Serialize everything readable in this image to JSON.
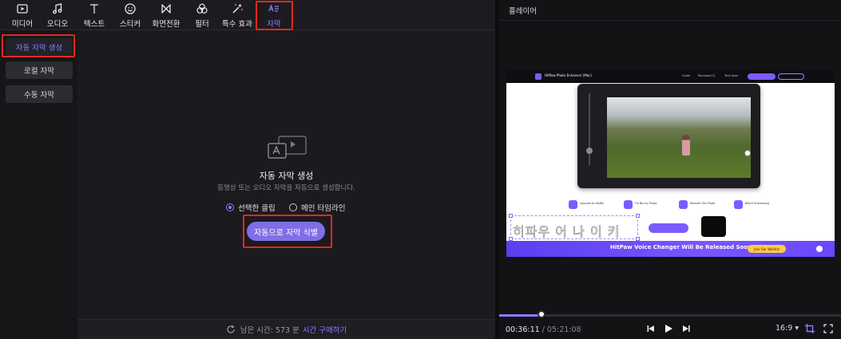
{
  "toolbar": {
    "tools": [
      {
        "label": "미디어",
        "icon": "media-icon"
      },
      {
        "label": "오디오",
        "icon": "music-note-icon"
      },
      {
        "label": "텍스트",
        "icon": "text-icon"
      },
      {
        "label": "스티커",
        "icon": "sticker-icon"
      },
      {
        "label": "화면전환",
        "icon": "transition-icon"
      },
      {
        "label": "필터",
        "icon": "filter-icon"
      },
      {
        "label": "특수 효과",
        "icon": "magic-wand-icon"
      },
      {
        "label": "자막",
        "icon": "subtitle-icon",
        "active": true
      }
    ]
  },
  "sidebar": {
    "items": [
      {
        "label": "자동 자막 생성",
        "active": true
      },
      {
        "label": "로컬 자막"
      },
      {
        "label": "수동 자막"
      }
    ]
  },
  "main": {
    "title": "자동 자막 생성",
    "description": "동영상 또는 오디오 자막을 자동으로 생성합니다.",
    "options": [
      {
        "label": "선택한 클립",
        "selected": true
      },
      {
        "label": "메인 타임라인",
        "selected": false
      }
    ],
    "generate_button": "자동으로 자막 식별"
  },
  "bottom_bar": {
    "remaining_label": "남은 시간: 573 분",
    "buy_link": "시간 구매하기"
  },
  "player": {
    "title": "플레이어",
    "current_time": "00:36:11",
    "separator": " / ",
    "total_time": "05:21:08",
    "progress": 0.123,
    "aspect_ratio": "16:9",
    "video": {
      "brand": "HitPaw Photo Enhancer (Mac)",
      "nav_items": [
        "Guide",
        "Reviews(37)",
        "Tech Spec"
      ],
      "features": [
        "Upscale to 4K/8K",
        "Fix Blurry Photo",
        "Restore Old Photo",
        "Batch Processing"
      ],
      "subtitle_ghost": "히파우 어 나 이 키",
      "banner_text": "HitPaw Voice Changer Will Be Released Soon!",
      "banner_button": "Join Our Waitlist"
    }
  },
  "colors": {
    "accent": "#8b7dff",
    "highlight_box": "#e0291f",
    "button": "#7f6ee6"
  }
}
